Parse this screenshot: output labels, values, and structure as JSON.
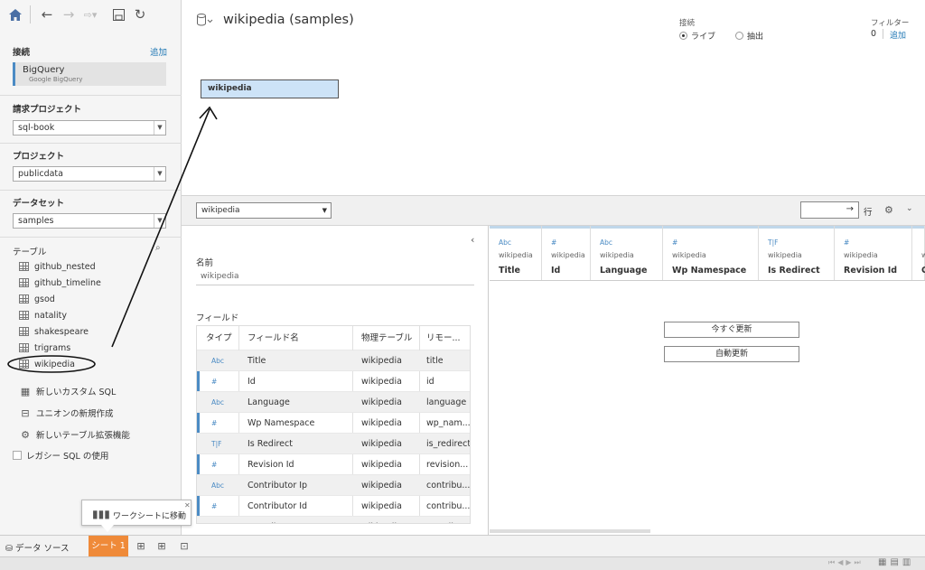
{
  "left": {
    "connections_title": "接続",
    "add_label": "追加",
    "connection": {
      "name": "BigQuery",
      "sub": "Google BigQuery"
    },
    "billing_project_title": "請求プロジェクト",
    "billing_project_value": "sql-book",
    "project_title": "プロジェクト",
    "project_value": "publicdata",
    "dataset_title": "データセット",
    "dataset_value": "samples",
    "tables_title": "テーブル",
    "tables": [
      "github_nested",
      "github_timeline",
      "gsod",
      "natality",
      "shakespeare",
      "trigrams",
      "wikipedia"
    ],
    "actions": [
      "新しいカスタム SQL",
      "ユニオンの新規作成",
      "新しいテーブル拡張機能"
    ],
    "legacy_sql": "レガシー SQL の使用"
  },
  "canvas": {
    "title": "wikipedia (samples)",
    "table_name": "wikipedia",
    "connection_label": "接続",
    "live": "ライブ",
    "extract": "抽出",
    "filter_label": "フィルター",
    "filter_count": "0",
    "filter_add": "追加"
  },
  "midbar": {
    "table_select": "wikipedia",
    "rows_arrow": "→",
    "rows_label": "行"
  },
  "meta": {
    "name_label": "名前",
    "name_value": "wikipedia",
    "fields_label": "フィールド",
    "headers": [
      "タイプ",
      "フィールド名",
      "物理テーブル",
      "リモー..."
    ],
    "rows": [
      {
        "type": "Abc",
        "name": "Title",
        "table": "wikipedia",
        "remote": "title"
      },
      {
        "type": "#",
        "name": "Id",
        "table": "wikipedia",
        "remote": "id"
      },
      {
        "type": "Abc",
        "name": "Language",
        "table": "wikipedia",
        "remote": "language"
      },
      {
        "type": "#",
        "name": "Wp Namespace",
        "table": "wikipedia",
        "remote": "wp_nam..."
      },
      {
        "type": "T|F",
        "name": "Is Redirect",
        "table": "wikipedia",
        "remote": "is_redirect"
      },
      {
        "type": "#",
        "name": "Revision Id",
        "table": "wikipedia",
        "remote": "revision..."
      },
      {
        "type": "Abc",
        "name": "Contributor Ip",
        "table": "wikipedia",
        "remote": "contribu..."
      },
      {
        "type": "#",
        "name": "Contributor Id",
        "table": "wikipedia",
        "remote": "contribu..."
      },
      {
        "type": "Abc",
        "name": "Contributor Username",
        "table": "wikipedia",
        "remote": "contribu..."
      }
    ]
  },
  "grid": {
    "columns": [
      {
        "type": "Abc",
        "source": "wikipedia",
        "name": "Title"
      },
      {
        "type": "#",
        "source": "wikipedia",
        "name": "Id"
      },
      {
        "type": "Abc",
        "source": "wikipedia",
        "name": "Language"
      },
      {
        "type": "#",
        "source": "wikipedia",
        "name": "Wp Namespace"
      },
      {
        "type": "T|F",
        "source": "wikipedia",
        "name": "Is Redirect"
      },
      {
        "type": "#",
        "source": "wikipedia",
        "name": "Revision Id"
      },
      {
        "type": "",
        "source": "w",
        "name": "C"
      }
    ],
    "update_now": "今すぐ更新",
    "auto_update": "自動更新"
  },
  "bottom": {
    "datasource_tab": "データ ソース",
    "sheet_tab": "シート 1",
    "tooltip": "ワークシートに移動"
  },
  "colors": {
    "accent": "#ef8a39",
    "link": "#1f77b4",
    "selected_table": "#cde3f7"
  }
}
